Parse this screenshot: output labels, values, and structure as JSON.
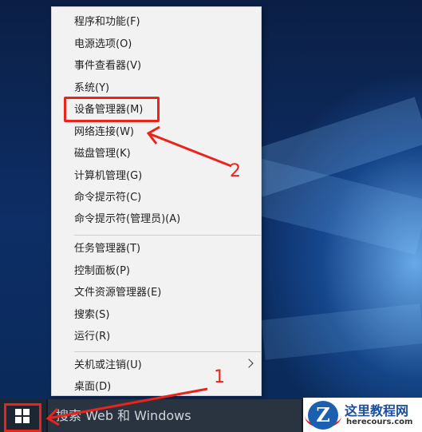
{
  "context_menu": {
    "items": [
      {
        "label": "程序和功能(F)"
      },
      {
        "label": "电源选项(O)"
      },
      {
        "label": "事件查看器(V)"
      },
      {
        "label": "系统(Y)"
      },
      {
        "label": "设备管理器(M)"
      },
      {
        "label": "网络连接(W)"
      },
      {
        "label": "磁盘管理(K)"
      },
      {
        "label": "计算机管理(G)"
      },
      {
        "label": "命令提示符(C)"
      },
      {
        "label": "命令提示符(管理员)(A)"
      },
      {
        "label": "任务管理器(T)"
      },
      {
        "label": "控制面板(P)"
      },
      {
        "label": "文件资源管理器(E)"
      },
      {
        "label": "搜索(S)"
      },
      {
        "label": "运行(R)"
      },
      {
        "label": "关机或注销(U)"
      },
      {
        "label": "桌面(D)"
      }
    ]
  },
  "taskbar": {
    "start_icon": "windows-logo-icon",
    "search_placeholder": "搜索 Web 和 Windows"
  },
  "annotations": {
    "label_1": "1",
    "label_2": "2",
    "color": "#e8241c"
  },
  "watermark": {
    "logo_letter": "Z",
    "name": "这里教程网",
    "url": "herecours.com"
  }
}
